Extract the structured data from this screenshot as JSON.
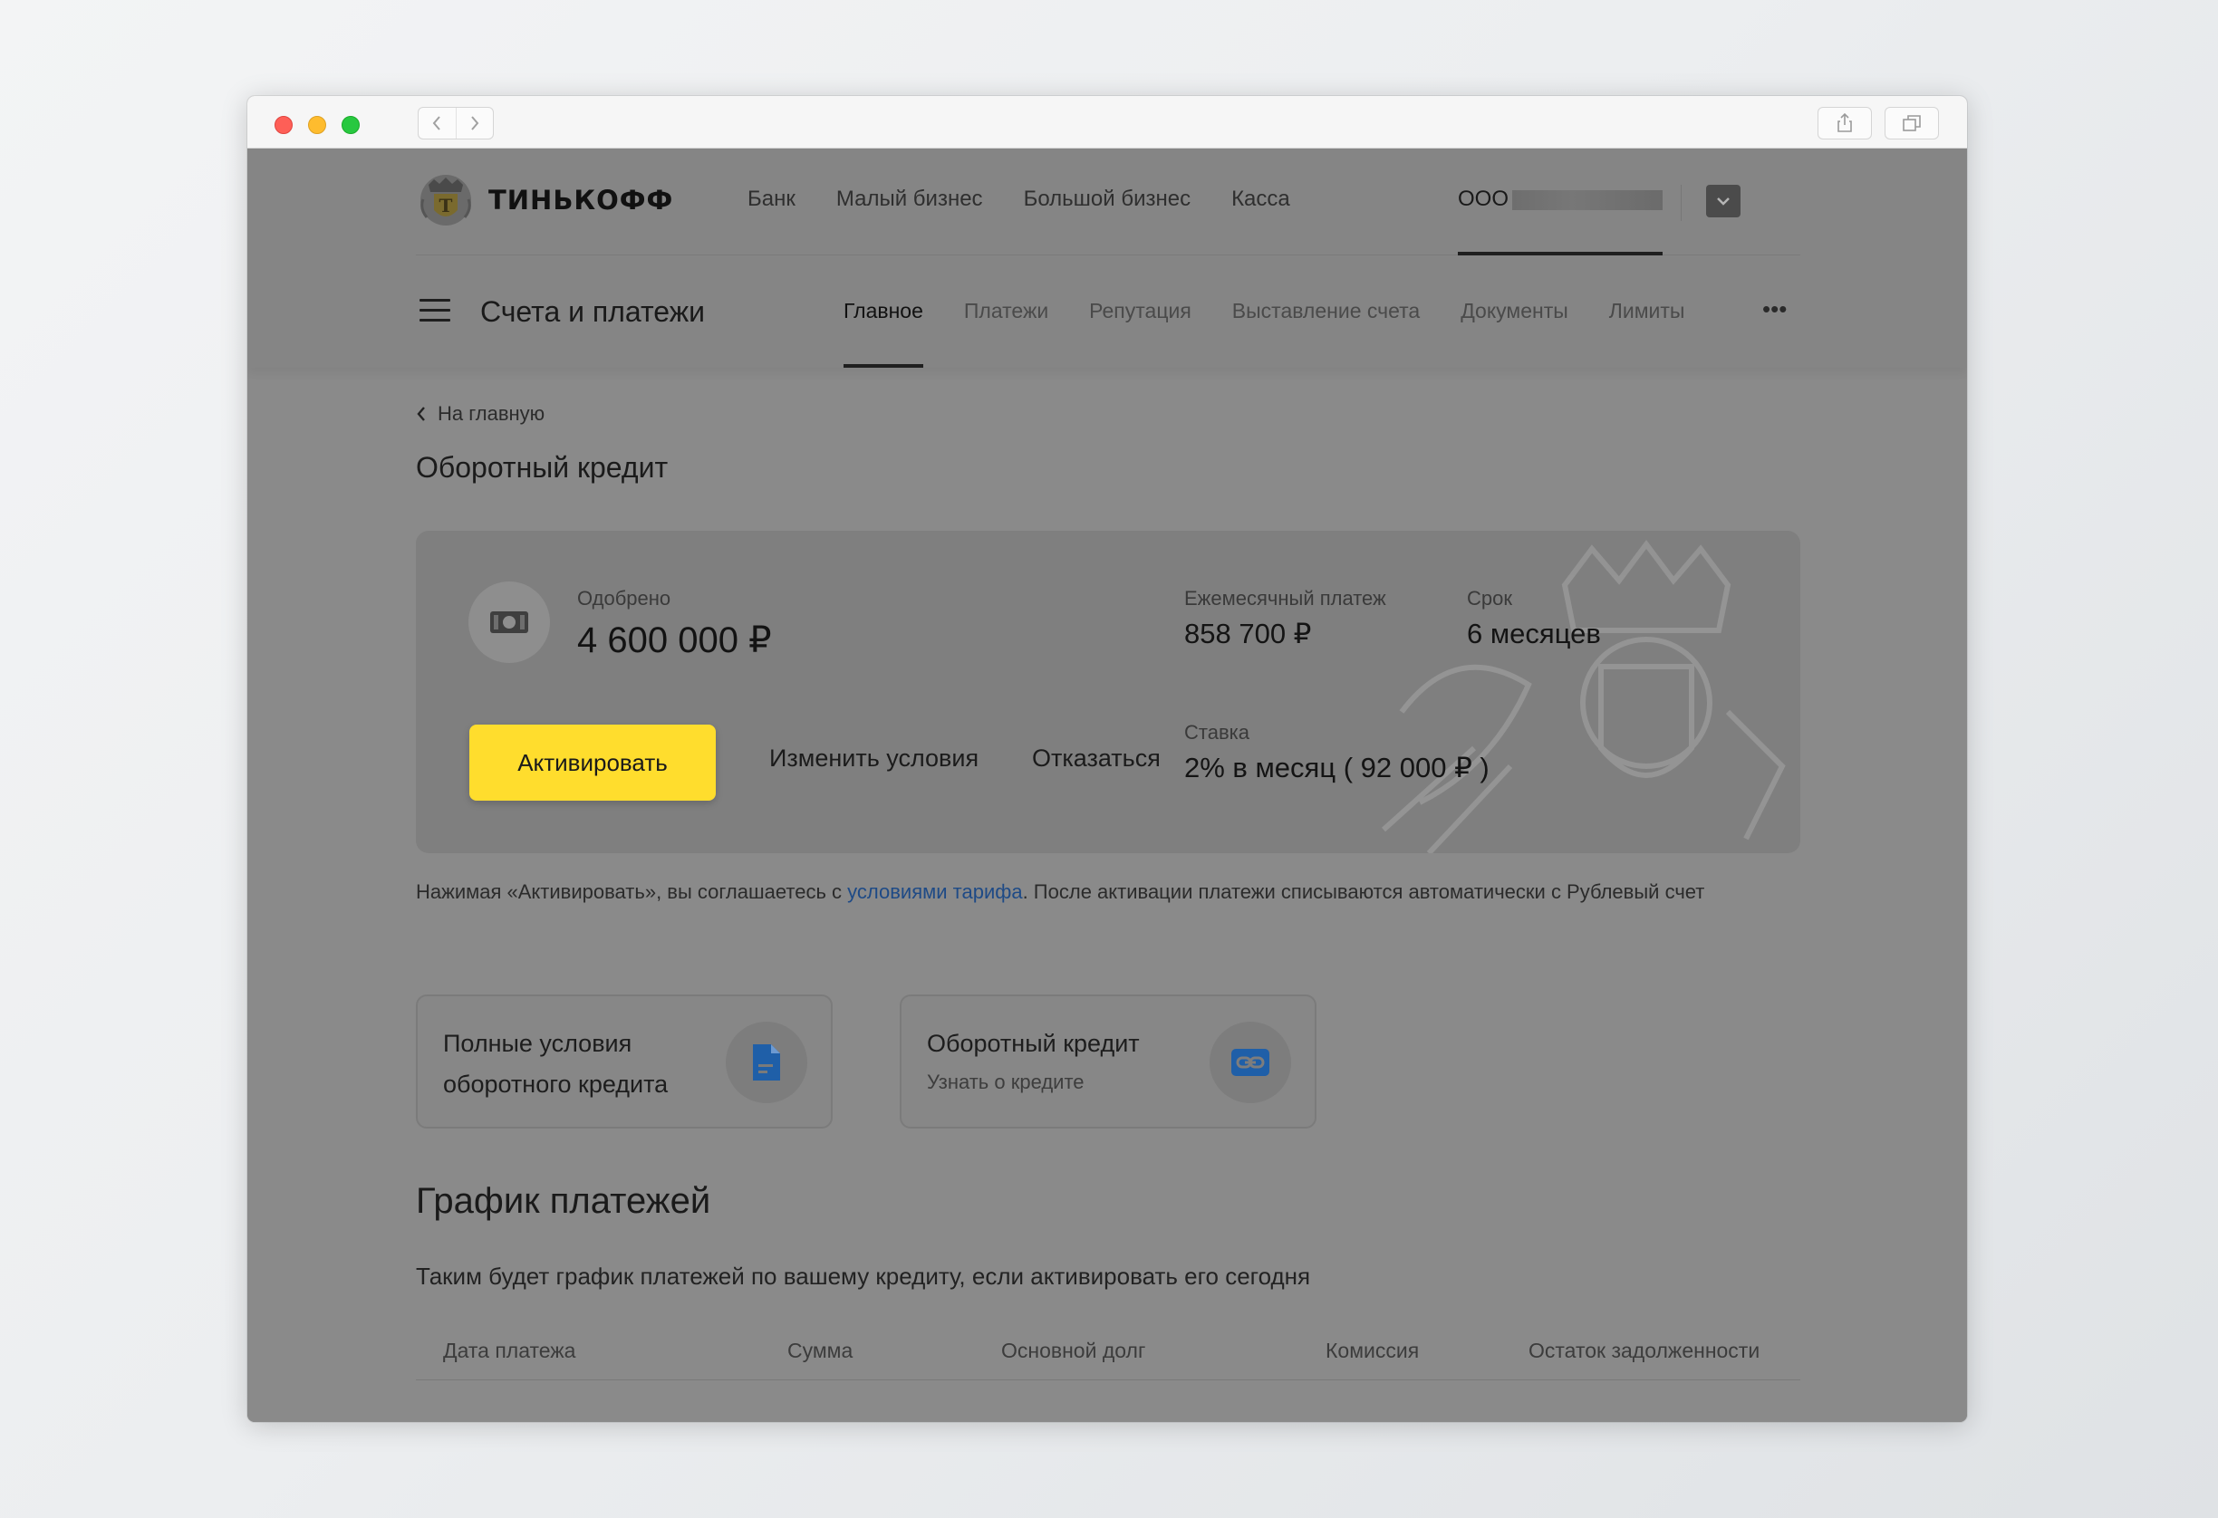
{
  "header": {
    "brand": "ТИНЬКОФФ",
    "nav": [
      "Банк",
      "Малый бизнес",
      "Большой бизнес",
      "Касса"
    ],
    "more": "•••",
    "org_name": "ООО"
  },
  "subnav": {
    "title": "Счета и платежи",
    "tabs": [
      "Главное",
      "Платежи",
      "Репутация",
      "Выставление счета",
      "Документы",
      "Лимиты"
    ],
    "more": "•••"
  },
  "page": {
    "back": "На главную",
    "title": "Оборотный кредит"
  },
  "credit": {
    "approved_label": "Одобрено",
    "approved_value": "4 600 000 ₽",
    "monthly_label": "Ежемесячный платеж",
    "monthly_value": "858 700 ₽",
    "term_label": "Срок",
    "term_value": "6 месяцев",
    "rate_label": "Ставка",
    "rate_value": "2% в месяц ( 92 000 ₽ )",
    "activate_button": "Активировать",
    "change_button": "Изменить условия",
    "decline_button": "Отказаться"
  },
  "agreement": {
    "before": "Нажимая «Активировать», вы соглашаетесь с ",
    "link": "условиями тарифа",
    "after": ". После активации платежи списываются автоматически с Рублевый счет"
  },
  "tiles": [
    {
      "title_line1": "Полные условия",
      "title_line2": "оборотного кредита",
      "icon": "document-icon"
    },
    {
      "title": "Оборотный кредит",
      "subtitle": "Узнать о кредите",
      "icon": "link-icon"
    }
  ],
  "schedule": {
    "title": "График платежей",
    "description": "Таким будет график платежей по вашему кредиту, если активировать его сегодня",
    "columns": [
      "Дата платежа",
      "Сумма",
      "Основной долг",
      "Комиссия",
      "Остаток задолженности"
    ]
  },
  "colors": {
    "accent_yellow": "#ffdd2d",
    "link_blue": "#1e4a86",
    "icon_blue": "#1f5fa8",
    "overlay_gray": "#8a8a8a"
  }
}
